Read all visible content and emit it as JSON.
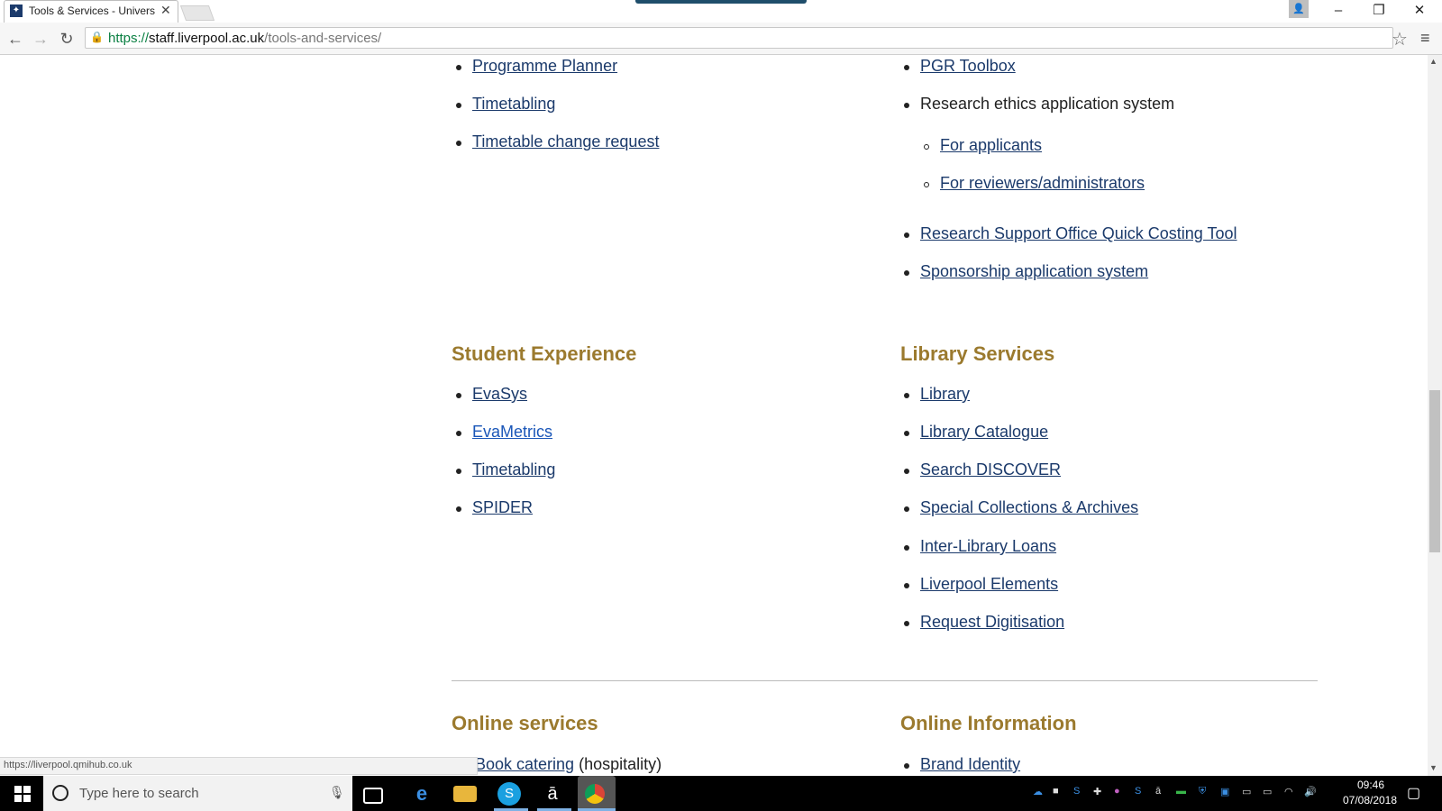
{
  "browser": {
    "tab_title": "Tools & Services - Univers",
    "tab_close": "✕",
    "url_scheme": "https://",
    "url_host": "staff.liverpool.ac.uk",
    "url_path": "/tools-and-services/",
    "status_url": "https://liverpool.qmihub.co.uk",
    "window_controls": [
      "–",
      "❐",
      "✕"
    ]
  },
  "content": {
    "left_top_links": [
      "Programme Planner",
      "Timetabling",
      "Timetable change request"
    ],
    "right_top": {
      "pgr": "PGR Toolbox",
      "research_ethics": "Research ethics application system",
      "sub_links": [
        "For applicants",
        "For reviewers/administrators"
      ],
      "rso": "Research Support Office Quick Costing Tool",
      "sponsorship": "Sponsorship application system"
    },
    "student_experience": {
      "heading": "Student Experience",
      "links": [
        "EvaSys",
        "EvaMetrics",
        "Timetabling",
        "SPIDER"
      ]
    },
    "library_services": {
      "heading": "Library Services",
      "links": [
        "Library",
        "Library Catalogue",
        "Search DISCOVER",
        "Special Collections & Archives",
        "Inter-Library Loans",
        "Liverpool Elements",
        "Request Digitisation"
      ]
    },
    "online_services": {
      "heading": "Online services",
      "first_link": "Book catering",
      "first_suffix": " (hospitality)"
    },
    "online_information": {
      "heading": "Online Information",
      "first_link": "Brand Identity"
    }
  },
  "taskbar": {
    "search_placeholder": "Type here to search",
    "time": "09:46",
    "date": "07/08/2018"
  },
  "colors": {
    "heading": "#9b7a2e",
    "link": "#1b3a6b",
    "visited_link": "#1a56b8"
  }
}
